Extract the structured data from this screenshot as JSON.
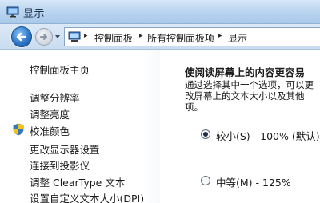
{
  "window": {
    "title": "显示",
    "title_icon": "monitor-icon"
  },
  "nav": {
    "back_icon": "back-arrow-icon",
    "forward_icon": "forward-arrow-icon",
    "address": {
      "icon": "control-panel-icon",
      "breadcrumbs": [
        "控制面板",
        "所有控制面板项",
        "显示"
      ]
    }
  },
  "sidebar": {
    "items": [
      {
        "label": "控制面板主页",
        "icon": ""
      },
      {
        "label": "调整分辨率",
        "icon": ""
      },
      {
        "label": "调整亮度",
        "icon": ""
      },
      {
        "label": "校准颜色",
        "icon": "shield-icon"
      },
      {
        "label": "更改显示器设置",
        "icon": ""
      },
      {
        "label": "连接到投影仪",
        "icon": ""
      },
      {
        "label": "调整 ClearType 文本",
        "icon": ""
      },
      {
        "label": "设置自定义文本大小(DPI)",
        "icon": ""
      }
    ]
  },
  "main": {
    "title": "使阅读屏幕上的内容更容易",
    "description": "通过选择其中一个选项，可以更改屏幕上的文本大小以及其他项。",
    "options": [
      {
        "label": "较小(S) - 100% (默认)",
        "selected": true
      },
      {
        "label": "中等(M) - 125%",
        "selected": false
      }
    ]
  },
  "colors": {
    "titlebar": "#bcd6f0",
    "back_button": "#2f78c8",
    "text": "#1a1a1a"
  }
}
